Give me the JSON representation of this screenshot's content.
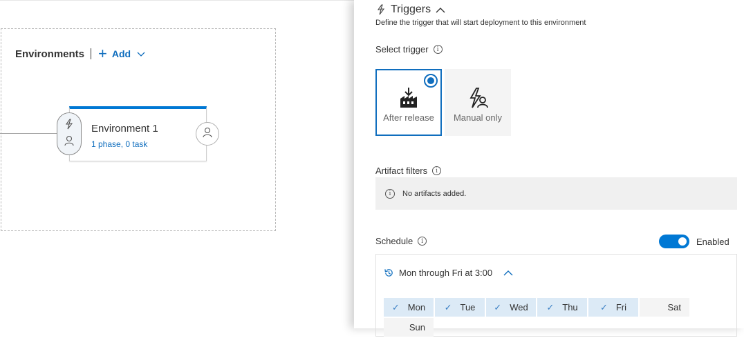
{
  "pipeline": {
    "environments_title": "Environments",
    "add_label": "Add",
    "environment": {
      "name": "Environment 1",
      "summary": "1 phase, 0 task"
    }
  },
  "triggers_panel": {
    "title": "Triggers",
    "description": "Define the trigger that will start deployment to this environment",
    "select_trigger_label": "Select trigger",
    "trigger_options": [
      {
        "label": "After release",
        "selected": true
      },
      {
        "label": "Manual only",
        "selected": false
      }
    ],
    "artifact_filters_label": "Artifact filters",
    "no_artifacts_text": "No artifacts added.",
    "schedule_label": "Schedule",
    "schedule_toggle_label": "Enabled",
    "schedule_enabled": true,
    "schedule_summary": "Mon through Fri at 3:00",
    "days": [
      {
        "label": "Mon",
        "checked": true
      },
      {
        "label": "Tue",
        "checked": true
      },
      {
        "label": "Wed",
        "checked": true
      },
      {
        "label": "Thu",
        "checked": true
      },
      {
        "label": "Fri",
        "checked": true
      },
      {
        "label": "Sat",
        "checked": false
      },
      {
        "label": "Sun",
        "checked": false
      }
    ]
  },
  "colors": {
    "accent": "#0078d4",
    "link": "#106ebe",
    "day_selected_bg": "#dceaf6"
  },
  "icons": {
    "info": "i"
  }
}
